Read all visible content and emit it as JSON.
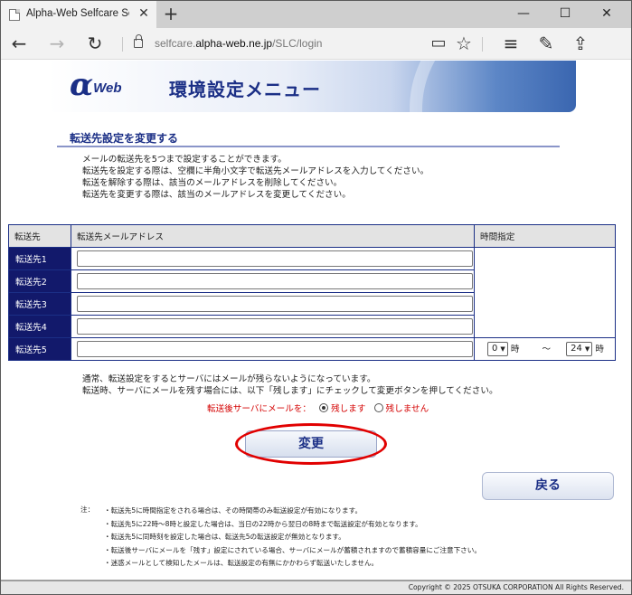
{
  "browser": {
    "tab_title": "Alpha-Web Selfcare Ser",
    "tab_close": "✕",
    "new_tab": "+",
    "minimize": "—",
    "maximize": "☐",
    "close": "✕",
    "back": "←",
    "forward": "→",
    "refresh": "↻",
    "url_prefix": "selfcare.",
    "url_host": "alpha-web.ne.jp",
    "url_path": "/SLC/login",
    "reading_view": "▭",
    "favorite": "☆",
    "hub": "≡",
    "notes": "✎",
    "share": "⇪"
  },
  "banner": {
    "logo_alpha": "α",
    "logo_web": "Web",
    "title": "環境設定メニュー"
  },
  "section": {
    "title": "転送先設定を変更する",
    "description": [
      "メールの転送先を5つまで設定することができます。",
      "転送先を設定する際は、空欄に半角小文字で転送先メールアドレスを入力してください。",
      "転送を解除する際は、該当のメールアドレスを削除してください。",
      "転送先を変更する際は、該当のメールアドレスを変更してください。"
    ]
  },
  "table": {
    "headers": [
      "転送先",
      "転送先メールアドレス",
      "時間指定"
    ],
    "rows": [
      {
        "label": "転送先1",
        "value": ""
      },
      {
        "label": "転送先2",
        "value": ""
      },
      {
        "label": "転送先3",
        "value": ""
      },
      {
        "label": "転送先4",
        "value": ""
      },
      {
        "label": "転送先5",
        "value": ""
      }
    ],
    "time_start": "0",
    "time_start_unit": "時",
    "time_separator": "〜",
    "time_end": "24",
    "time_end_unit": "時"
  },
  "keep": {
    "info": [
      "通常、転送設定をするとサーバにはメールが残らないようになっています。",
      "転送時、サーバにメールを残す場合には、以下「残します」にチェックして変更ボタンを押してください。"
    ],
    "label": "転送後サーバにメールを：",
    "option_keep": "残します",
    "option_discard": "残しません",
    "selected": "残します"
  },
  "buttons": {
    "change": "変更",
    "back": "戻る"
  },
  "notes": {
    "label": "注：",
    "items": [
      "転送先5に時間指定をされる場合は、その時間帯のみ転送設定が有効になります。",
      "転送先5に22時〜8時と設定した場合は、当日の22時から翌日の8時まで転送設定が有効となります。",
      "転送先5に同時刻を設定した場合は、転送先5の転送設定が無効となります。",
      "転送後サーバにメールを「残す」設定にされている場合、サーバにメールが蓄積されますので蓄積容量にご注意下さい。",
      "迷惑メールとして検知したメールは、転送設定の有無にかかわらず転送いたしません。"
    ]
  },
  "footer": {
    "copyright": "Copyright © 2025 OTSUKA CORPORATION All Rights Reserved."
  },
  "colors": {
    "navy": "#12196b",
    "accent_blue": "#1b2f86",
    "highlight_red": "#e10000"
  }
}
